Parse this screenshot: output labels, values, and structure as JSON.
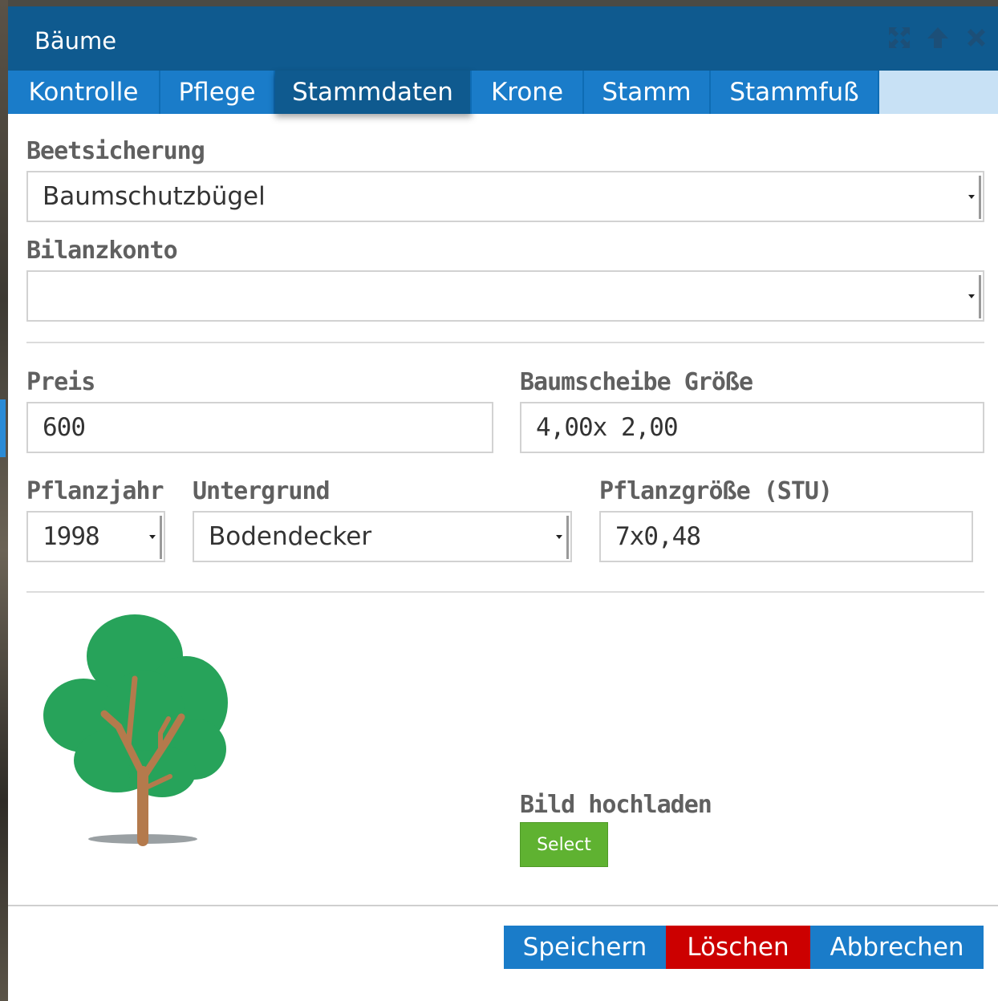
{
  "window": {
    "title": "Bäume"
  },
  "tabs": [
    {
      "label": "Kontrolle",
      "active": false
    },
    {
      "label": "Pflege",
      "active": false
    },
    {
      "label": "Stammdaten",
      "active": true
    },
    {
      "label": "Krone",
      "active": false
    },
    {
      "label": "Stamm",
      "active": false
    },
    {
      "label": "Stammfuß",
      "active": false
    }
  ],
  "form": {
    "beetsicherung": {
      "label": "Beetsicherung",
      "value": "Baumschutzbügel"
    },
    "bilanzkonto": {
      "label": "Bilanzkonto",
      "value": ""
    },
    "preis": {
      "label": "Preis",
      "value": "600"
    },
    "baumscheibe": {
      "label": "Baumscheibe Größe",
      "value": "4,00x 2,00"
    },
    "pflanzjahr": {
      "label": "Pflanzjahr",
      "value": "1998"
    },
    "untergrund": {
      "label": "Untergrund",
      "value": "Bodendecker"
    },
    "pflanzgroesse": {
      "label": "Pflanzgröße (STU)",
      "value": "7x0,48"
    }
  },
  "upload": {
    "label": "Bild hochladen",
    "button": "Select"
  },
  "footer": {
    "save": "Speichern",
    "delete": "Löschen",
    "cancel": "Abbrechen"
  },
  "colors": {
    "titlebar": "#0f5a8f",
    "tab": "#1a7cc9",
    "delete": "#cc0000",
    "select": "#5fb231",
    "tree_green": "#27a35a",
    "trunk": "#b47a4c"
  },
  "icons": [
    "expand-icon",
    "arrow-up-icon",
    "close-icon",
    "tree-icon"
  ]
}
